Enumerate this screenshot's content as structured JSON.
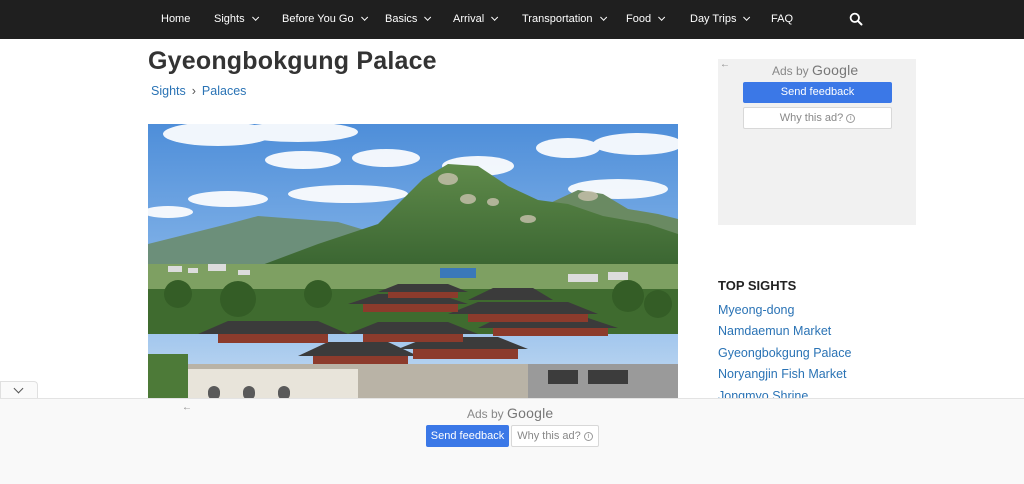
{
  "nav": {
    "items": [
      {
        "label": "Home",
        "dropdown": false
      },
      {
        "label": "Sights",
        "dropdown": true
      },
      {
        "label": "Before You Go",
        "dropdown": true
      },
      {
        "label": "Basics",
        "dropdown": true
      },
      {
        "label": "Arrival",
        "dropdown": true
      },
      {
        "label": "Transportation",
        "dropdown": true
      },
      {
        "label": "Food",
        "dropdown": true
      },
      {
        "label": "Day Trips",
        "dropdown": true
      },
      {
        "label": "FAQ",
        "dropdown": false
      }
    ],
    "search_icon": "search-icon"
  },
  "page": {
    "title": "Gyeongbokgung Palace",
    "breadcrumb": [
      "Sights",
      "Palaces"
    ],
    "breadcrumb_separator": "›"
  },
  "side_ad": {
    "back_glyph": "←",
    "ads_by": "Ads by",
    "google": "Google",
    "feedback_label": "Send feedback",
    "why_label": "Why this ad?",
    "info_glyph": "i"
  },
  "top_sights": {
    "heading": "TOP SIGHTS",
    "items": [
      "Myeong-dong",
      "Namdaemun Market",
      "Gyeongbokgung Palace",
      "Noryangjin Fish Market",
      "Jongmyo Shrine"
    ]
  },
  "bottom_ad": {
    "back_glyph": "←",
    "ads_by": "Ads by",
    "google": "Google",
    "feedback_label": "Send feedback",
    "why_label": "Why this ad?",
    "info_glyph": "i"
  },
  "colors": {
    "nav_bg": "#1f1f1f",
    "link": "#2a73b5",
    "feedback_button": "#3b78e7"
  }
}
